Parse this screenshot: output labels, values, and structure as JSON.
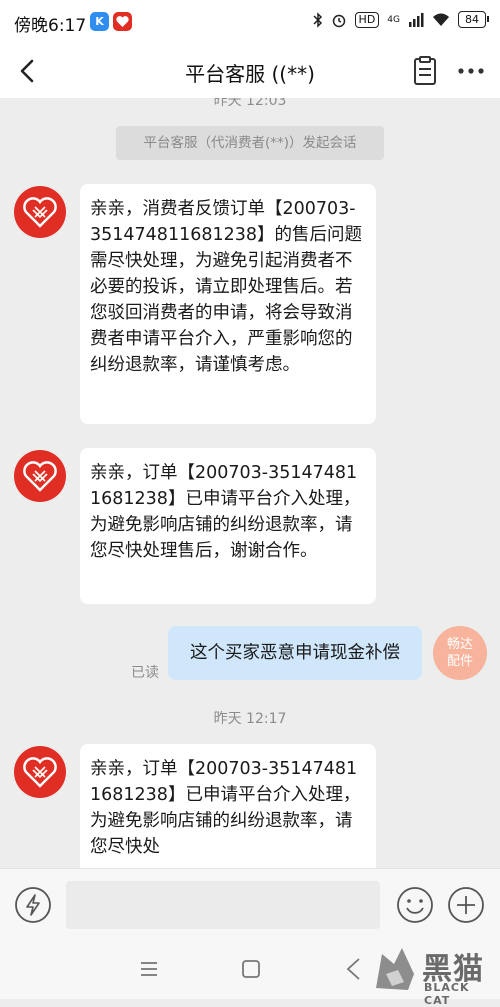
{
  "status_bar": {
    "time": "傍晚6:17",
    "app_icon_k": "K",
    "hd": "HD",
    "network": "4G",
    "battery": "84"
  },
  "header": {
    "title": "平台客服 ((**)"
  },
  "chat": {
    "timestamp_top_partial": "昨天 12:03",
    "system_notice": "平台客服（代消费者(**)）发起会话",
    "messages": [
      {
        "text": "亲亲，消费者反馈订单【200703-351474811681238】的售后问题需尽快处理，为避免引起消费者不必要的投诉，请立即处理售后。若您驳回消费者的申请，将会导致消费者申请平台介入，严重影响您的纠纷退款率，请谨慎考虑。"
      },
      {
        "text": "亲亲，订单【200703-351474811681238】已申请平台介入处理，为避免影响店铺的纠纷退款率，请您尽快处理售后，谢谢合作。"
      },
      {
        "text": "亲亲，订单【200703-351474811681238】已申请平台介入处理，为避免影响店铺的纠纷退款率，请您尽快处"
      }
    ],
    "outgoing": {
      "text": "这个买家恶意申请现金补偿",
      "read_status": "已读",
      "agent_line1": "畅达",
      "agent_line2": "配件"
    },
    "timestamp_mid": "昨天 12:17"
  },
  "watermark": {
    "cn": "黑猫",
    "en": "BLACK CAT"
  },
  "colors": {
    "brand_red": "#e02e24",
    "outgoing_bubble": "#cfe6fb",
    "agent_avatar": "#f7b39b"
  },
  "icons": [
    "back-arrow-icon",
    "document-icon",
    "more-icon",
    "voice-icon",
    "emoji-icon",
    "plus-icon",
    "menu-icon",
    "home-icon",
    "triangle-back-icon",
    "bluetooth-icon",
    "alarm-icon",
    "signal-icon",
    "wifi-icon"
  ]
}
